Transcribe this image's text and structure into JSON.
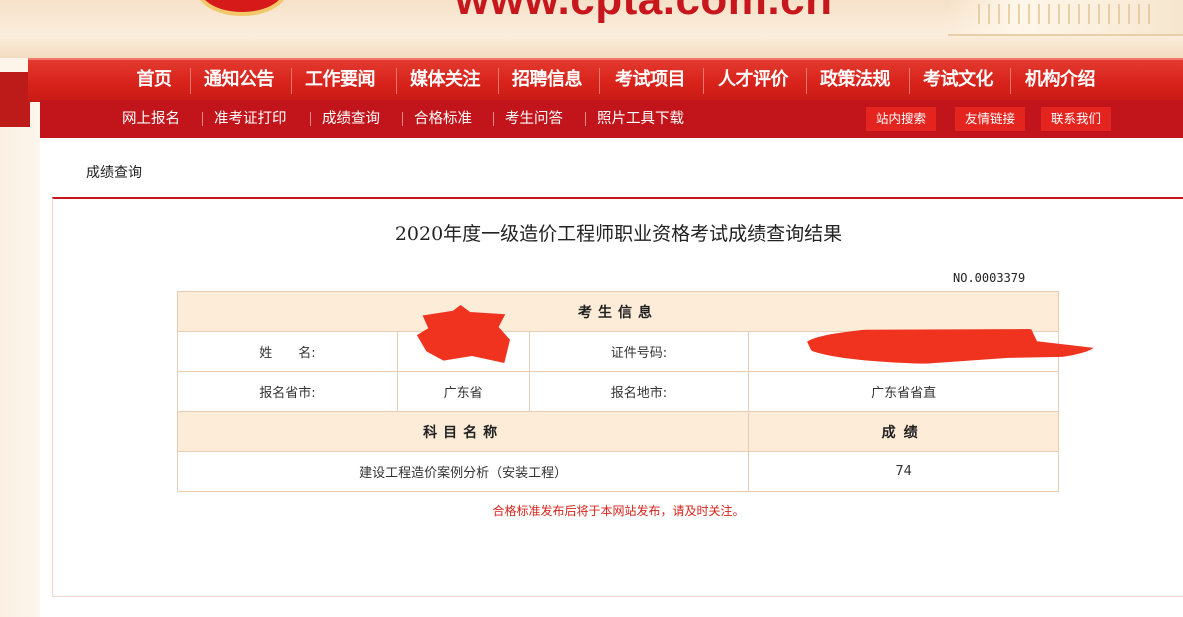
{
  "banner": {
    "url_text": "www.cpta.com.cn"
  },
  "main_nav": [
    "首页",
    "通知公告",
    "工作要闻",
    "媒体关注",
    "招聘信息",
    "考试项目",
    "人才评价",
    "政策法规",
    "考试文化",
    "机构介绍"
  ],
  "sub_nav": [
    "网上报名",
    "准考证打印",
    "成绩查询",
    "合格标准",
    "考生问答",
    "照片工具下载"
  ],
  "sub_buttons": [
    "站内搜索",
    "友情链接",
    "联系我们"
  ],
  "breadcrumb": "成绩查询",
  "result": {
    "title": "2020年度一级造价工程师职业资格考试成绩查询结果",
    "record_no": "NO.0003379",
    "section_header": "考生信息",
    "name_label": "姓　　名:",
    "name_value": "",
    "id_label": "证件号码:",
    "id_value": "",
    "province_label": "报名省市:",
    "province_value": "广东省",
    "city_label": "报名地市:",
    "city_value": "广东省省直",
    "subject_header": "科目名称",
    "score_header": "成绩",
    "subjects": [
      {
        "name": "建设工程造价案例分析（安装工程）",
        "score": "74"
      }
    ],
    "notice": "合格标准发布后将于本网站发布，请及时关注。"
  },
  "colors": {
    "brand_red": "#d8231b",
    "sub_nav_red": "#c2151b",
    "table_header_bg": "#fcecd8",
    "notice_red": "#d6231b"
  }
}
